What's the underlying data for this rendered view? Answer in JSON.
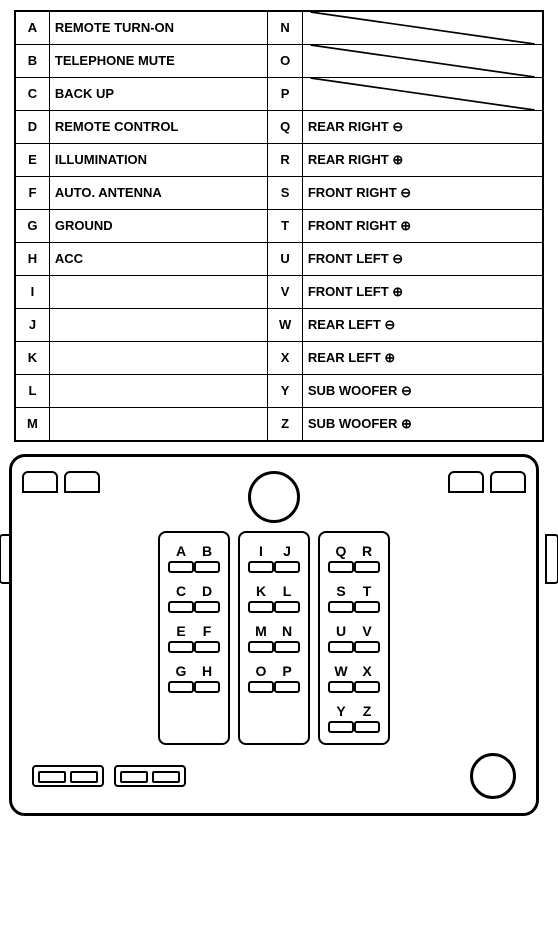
{
  "table": {
    "rows": [
      {
        "left_letter": "A",
        "left_label": "REMOTE TURN-ON",
        "right_letter": "N",
        "right_label": "",
        "right_symbol": ""
      },
      {
        "left_letter": "B",
        "left_label": "TELEPHONE MUTE",
        "right_letter": "O",
        "right_label": "",
        "right_symbol": ""
      },
      {
        "left_letter": "C",
        "left_label": "BACK UP",
        "right_letter": "P",
        "right_label": "",
        "right_symbol": ""
      },
      {
        "left_letter": "D",
        "left_label": "REMOTE CONTROL",
        "right_letter": "Q",
        "right_label": "REAR RIGHT",
        "right_symbol": "minus"
      },
      {
        "left_letter": "E",
        "left_label": "ILLUMINATION",
        "right_letter": "R",
        "right_label": "REAR RIGHT",
        "right_symbol": "plus"
      },
      {
        "left_letter": "F",
        "left_label": "AUTO. ANTENNA",
        "right_letter": "S",
        "right_label": "FRONT RIGHT",
        "right_symbol": "minus"
      },
      {
        "left_letter": "G",
        "left_label": "GROUND",
        "right_letter": "T",
        "right_label": "FRONT RIGHT",
        "right_symbol": "plus"
      },
      {
        "left_letter": "H",
        "left_label": "ACC",
        "right_letter": "U",
        "right_label": "FRONT LEFT",
        "right_symbol": "minus"
      },
      {
        "left_letter": "I",
        "left_label": "",
        "right_letter": "V",
        "right_label": "FRONT LEFT",
        "right_symbol": "plus"
      },
      {
        "left_letter": "J",
        "left_label": "",
        "right_letter": "W",
        "right_label": "REAR LEFT",
        "right_symbol": "minus"
      },
      {
        "left_letter": "K",
        "left_label": "",
        "right_letter": "X",
        "right_label": "REAR LEFT",
        "right_symbol": "plus"
      },
      {
        "left_letter": "L",
        "left_label": "",
        "right_letter": "Y",
        "right_label": "SUB WOOFER",
        "right_symbol": "minus"
      },
      {
        "left_letter": "M",
        "left_label": "",
        "right_letter": "Z",
        "right_label": "SUB WOOFER",
        "right_symbol": "plus"
      }
    ]
  },
  "connector": {
    "left_block": {
      "rows": [
        [
          {
            "letter": "A"
          },
          {
            "letter": "B"
          }
        ],
        [
          {
            "letter": "C"
          },
          {
            "letter": "D"
          }
        ],
        [
          {
            "letter": "E"
          },
          {
            "letter": "F"
          }
        ],
        [
          {
            "letter": "G"
          },
          {
            "letter": "H"
          }
        ]
      ]
    },
    "mid_block": {
      "rows": [
        [
          {
            "letter": "I"
          },
          {
            "letter": "J"
          }
        ],
        [
          {
            "letter": "K"
          },
          {
            "letter": "L"
          }
        ],
        [
          {
            "letter": "M"
          },
          {
            "letter": "N"
          }
        ],
        [
          {
            "letter": "O"
          },
          {
            "letter": "P"
          }
        ]
      ]
    },
    "right_block": {
      "rows": [
        [
          {
            "letter": "Q"
          },
          {
            "letter": "R"
          }
        ],
        [
          {
            "letter": "S"
          },
          {
            "letter": "T"
          }
        ],
        [
          {
            "letter": "U"
          },
          {
            "letter": "V"
          }
        ],
        [
          {
            "letter": "W"
          },
          {
            "letter": "X"
          }
        ],
        [
          {
            "letter": "Y"
          },
          {
            "letter": "Z"
          }
        ]
      ]
    }
  }
}
